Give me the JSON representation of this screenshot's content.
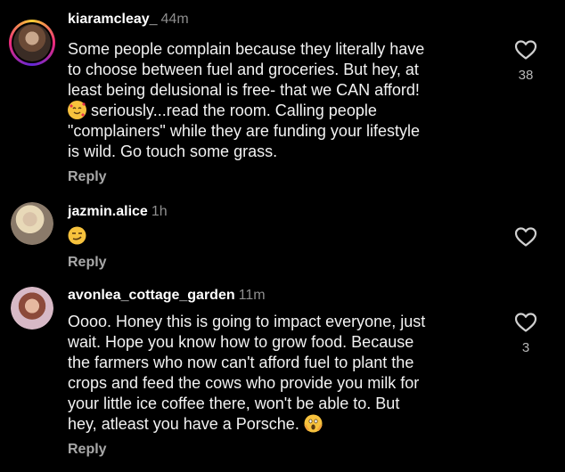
{
  "comments": [
    {
      "username": "kiaramcleay_",
      "time": "44m",
      "lines": [
        "Some people complain because they literally have",
        "to choose between fuel and groceries. But hey, at",
        "least being delusional is free- that we CAN afford!",
        "seriously...read the room. Calling people",
        "\"complainers\" while they are funding your lifestyle",
        "is wild. Go touch some grass."
      ],
      "emoji": "smiling-face-with-hearts",
      "likes": "38",
      "reply_label": "Reply"
    },
    {
      "username": "jazmin.alice",
      "time": "1h",
      "emoji": "smirking-face",
      "likes": "",
      "reply_label": "Reply"
    },
    {
      "username": "avonlea_cottage_garden",
      "time": "11m",
      "lines": [
        "Oooo. Honey this is going to impact everyone, just",
        "wait. Hope you know how to grow food. Because",
        "the farmers who now can't afford fuel to plant the",
        "crops and feed the cows who provide you milk for",
        "your little ice coffee there, won't be able to. But",
        "hey, atleast you have a Porsche."
      ],
      "emoji": "face-screaming",
      "likes": "3",
      "reply_label": "Reply"
    }
  ],
  "colors": {
    "background": "#000000",
    "text": "#f2f2f2",
    "muted": "#8e8e8e",
    "story_ring": "#ee2a7b"
  }
}
